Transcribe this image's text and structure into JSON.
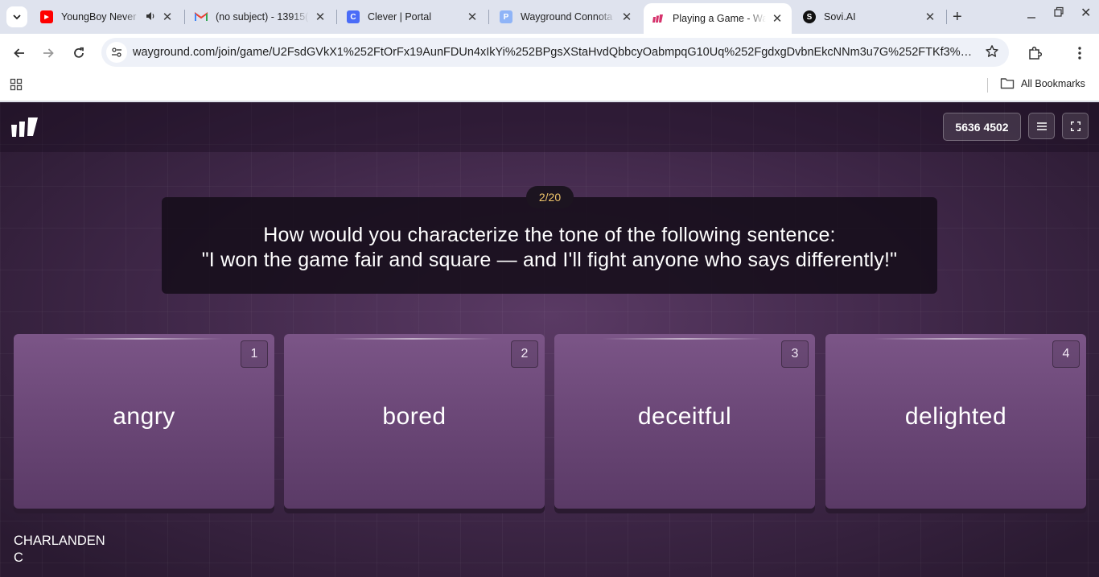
{
  "browser": {
    "tabs": [
      {
        "title": "YoungBoy Never",
        "favicon_color": "#ff0000",
        "favicon_glyph": "▶",
        "audio": true
      },
      {
        "title": "(no subject) - 13915(",
        "favicon_color": "#ffffff",
        "favicon_glyph": "M"
      },
      {
        "title": "Clever | Portal",
        "favicon_color": "#4a6cf7",
        "favicon_glyph": "C"
      },
      {
        "title": "Wayground Connota",
        "favicon_color": "#8fb4f7",
        "favicon_glyph": "P"
      },
      {
        "title": "Playing a Game - Wa",
        "favicon_color": "#ffffff",
        "favicon_glyph": "",
        "active": true
      },
      {
        "title": "Sovi.AI",
        "favicon_color": "#111111",
        "favicon_glyph": "S"
      }
    ],
    "url": "wayground.com/join/game/U2FsdGVkX1%252FtOrFx19AunFDUn4xIkYi%252BPgsXStaHvdQbbcyOabmpqG10Uq%252FgdxgDvbnEkcNNm3u7G%252FTKf3%25...",
    "bookmarks_all_label": "All Bookmarks"
  },
  "game": {
    "join_code": "5636 4502",
    "question_counter": "2/20",
    "question_lines": [
      "How would you characterize the tone of the following sentence:",
      "\"I won the game fair and square — and I'll fight anyone who says differently!\""
    ],
    "options": [
      {
        "number": "1",
        "label": "angry"
      },
      {
        "number": "2",
        "label": "bored"
      },
      {
        "number": "3",
        "label": "deceitful"
      },
      {
        "number": "4",
        "label": "delighted"
      }
    ],
    "player_name_line1": "CHARLANDEN",
    "player_name_line2": "C"
  }
}
